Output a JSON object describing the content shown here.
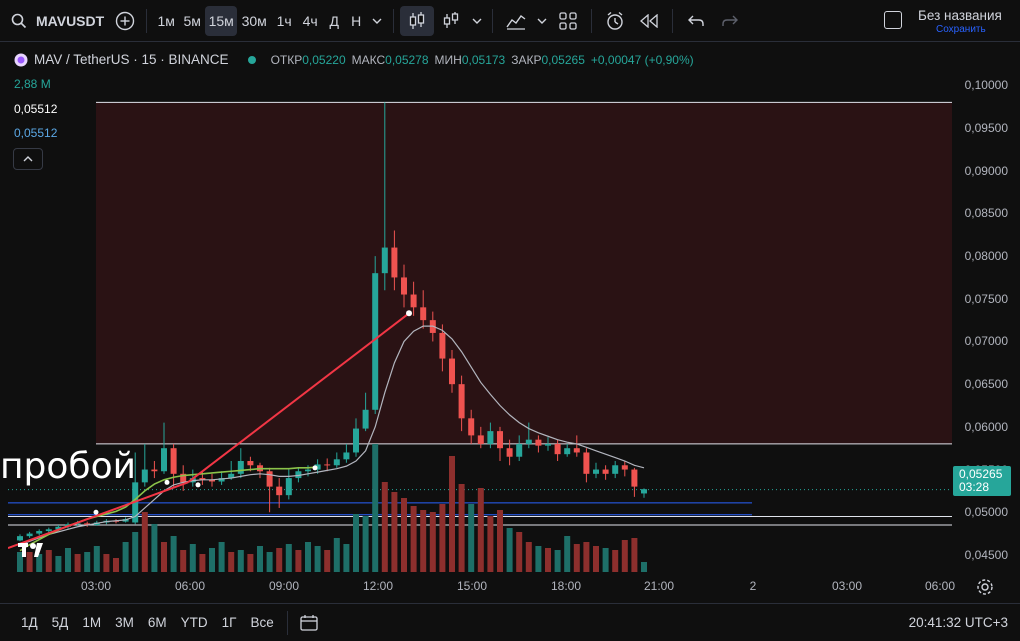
{
  "toolbar": {
    "symbol": "MAVUSDT",
    "intervals": [
      "1м",
      "5м",
      "15м",
      "30м",
      "1ч",
      "4ч",
      "Д",
      "Н"
    ],
    "active_interval": "15м",
    "layout_name": "Без названия",
    "save_label": "Сохранить"
  },
  "legend": {
    "title": "MAV / TetherUS · 15 · BINANCE",
    "open_label": "ОТКР",
    "open": "0,05220",
    "high_label": "МАКС",
    "high": "0,05278",
    "low_label": "МИН",
    "low": "0,05173",
    "close_label": "ЗАКР",
    "close": "0,05265",
    "change": "+0,00047 (+0,90%)",
    "volume": "2,88 М",
    "indicator1": "0,05512",
    "indicator2": "0,05512"
  },
  "price_axis": {
    "labels": [
      "0,10000",
      "0,09500",
      "0,09000",
      "0,08500",
      "0,08000",
      "0,07500",
      "0,07000",
      "0,06500",
      "0,06000",
      "0,05500",
      "0,05000",
      "0,04500"
    ],
    "current_price": "0,05265",
    "countdown": "03:28"
  },
  "time_axis": {
    "labels": [
      "03:00",
      "06:00",
      "09:00",
      "12:00",
      "15:00",
      "18:00",
      "21:00",
      "2",
      "03:00",
      "06:00"
    ]
  },
  "bottom": {
    "ranges": [
      "1Д",
      "5Д",
      "1М",
      "3М",
      "6М",
      "YTD",
      "1Г",
      "Все"
    ],
    "clock": "20:41:32 UTC+3"
  },
  "annotation": {
    "text": "пробой"
  },
  "colors": {
    "up": "#26a69a",
    "down": "#ef5350",
    "zone": "#2a1214",
    "trend": "#f23645",
    "ma": "#b2b5be",
    "volume_up": "#1e6f68",
    "volume_down": "#8d2f2d"
  },
  "chart_data": {
    "type": "candlestick",
    "title": "MAV / TetherUS · 15 · BINANCE",
    "x_labels": [
      "03:00",
      "06:00",
      "09:00",
      "12:00",
      "15:00",
      "18:00",
      "21:00",
      "2",
      "03:00",
      "06:00"
    ],
    "y_range": [
      0.043,
      0.1025
    ],
    "ylabels": [
      "0,10000",
      "0,09500",
      "0,09000",
      "0,08500",
      "0,08000",
      "0,07500",
      "0,07000",
      "0,06500",
      "0,06000",
      "0,05500",
      "0,05000",
      "0,04500"
    ],
    "horizontal_levels": [
      0.098,
      0.058,
      0.0495,
      0.0485
    ],
    "volume_label": "2,88 М"
  }
}
